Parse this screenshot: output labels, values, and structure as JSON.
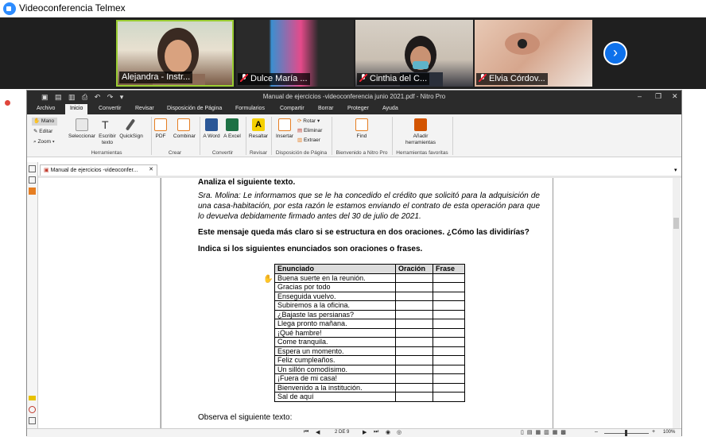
{
  "conference": {
    "title": "Videoconferencia Telmex",
    "participants": [
      {
        "name": "Alejandra - Instr...",
        "muted": false
      },
      {
        "name": "Dulce María ...",
        "muted": true
      },
      {
        "name": "Cinthia del C...",
        "muted": true
      },
      {
        "name": "Elvia Córdov...",
        "muted": true
      }
    ],
    "next_icon": "chevron-right-icon",
    "record_label": "Grabar",
    "accent": "#0e71eb"
  },
  "app": {
    "window_title": "Manual de ejercicios -videoconferencia junio 2021.pdf - Nitro Pro",
    "tabs": [
      "Archivo",
      "Inicio",
      "Convertir",
      "Revisar",
      "Disposición de Página",
      "Formularios",
      "Compartir",
      "Borrar",
      "Proteger",
      "Ayuda"
    ],
    "ribbon": {
      "herramientas": {
        "mano": "Mano",
        "editar": "Editar",
        "zoom": "Zoom",
        "seleccionar": "Seleccionar",
        "escribir": "Escribir texto",
        "quicksign": "QuickSign",
        "label": "Herramientas"
      },
      "crear": {
        "pdf": "PDF",
        "combinar": "Combinar",
        "label": "Crear"
      },
      "convertir": {
        "word": "A Word",
        "excel": "A Excel",
        "label": "Convertir"
      },
      "revisar": {
        "resaltar": "Resaltar",
        "label": "Revisar"
      },
      "disposicion": {
        "insertar": "Insertar",
        "rotar": "Rotar",
        "eliminar": "Eliminar",
        "extraer": "Extraer",
        "label": "Disposición de Página"
      },
      "bienvenido": {
        "find": "Find",
        "label": "Bienvenido a Nitro Pro"
      },
      "favoritas": {
        "anadir": "Añadir herramientas",
        "label": "Herramientas favoritas"
      }
    },
    "doc_tab": "Manual de ejercicios -videoconfer..."
  },
  "page": {
    "heading": "Analiza el siguiente texto.",
    "quote": "Sra. Molina: Le informamos que se le ha concedido el crédito que solicitó para la adquisición de una casa-habitación, por esta razón le estamos enviando el contrato de esta operación para que lo devuelva debidamente firmado antes del 30 de julio de 2021.",
    "q1": "Este mensaje queda más claro si se estructura en dos oraciones. ¿Cómo las dividirías?",
    "q2": "Indica si los siguientes enunciados son oraciones o frases.",
    "table": {
      "headers": [
        "Enunciado",
        "Oración",
        "Frase"
      ],
      "rows": [
        "Buena suerte en la reunión.",
        "Gracias por todo",
        "Enseguida vuelvo.",
        "Subiremos a la oficina.",
        "¿Bajaste las persianas?",
        "Llega pronto mañana.",
        "¡Qué hambre!",
        "Come tranquila.",
        "Espera un momento.",
        "Feliz cumpleaños.",
        "Un sillón comodísimo.",
        "¡Fuera de mi casa!",
        "Bienvenido a la institución.",
        "Sal de aquí"
      ]
    },
    "footer_text": "Observa el siguiente texto:"
  },
  "status": {
    "page": "2 DE 9",
    "zoom": "100%"
  }
}
